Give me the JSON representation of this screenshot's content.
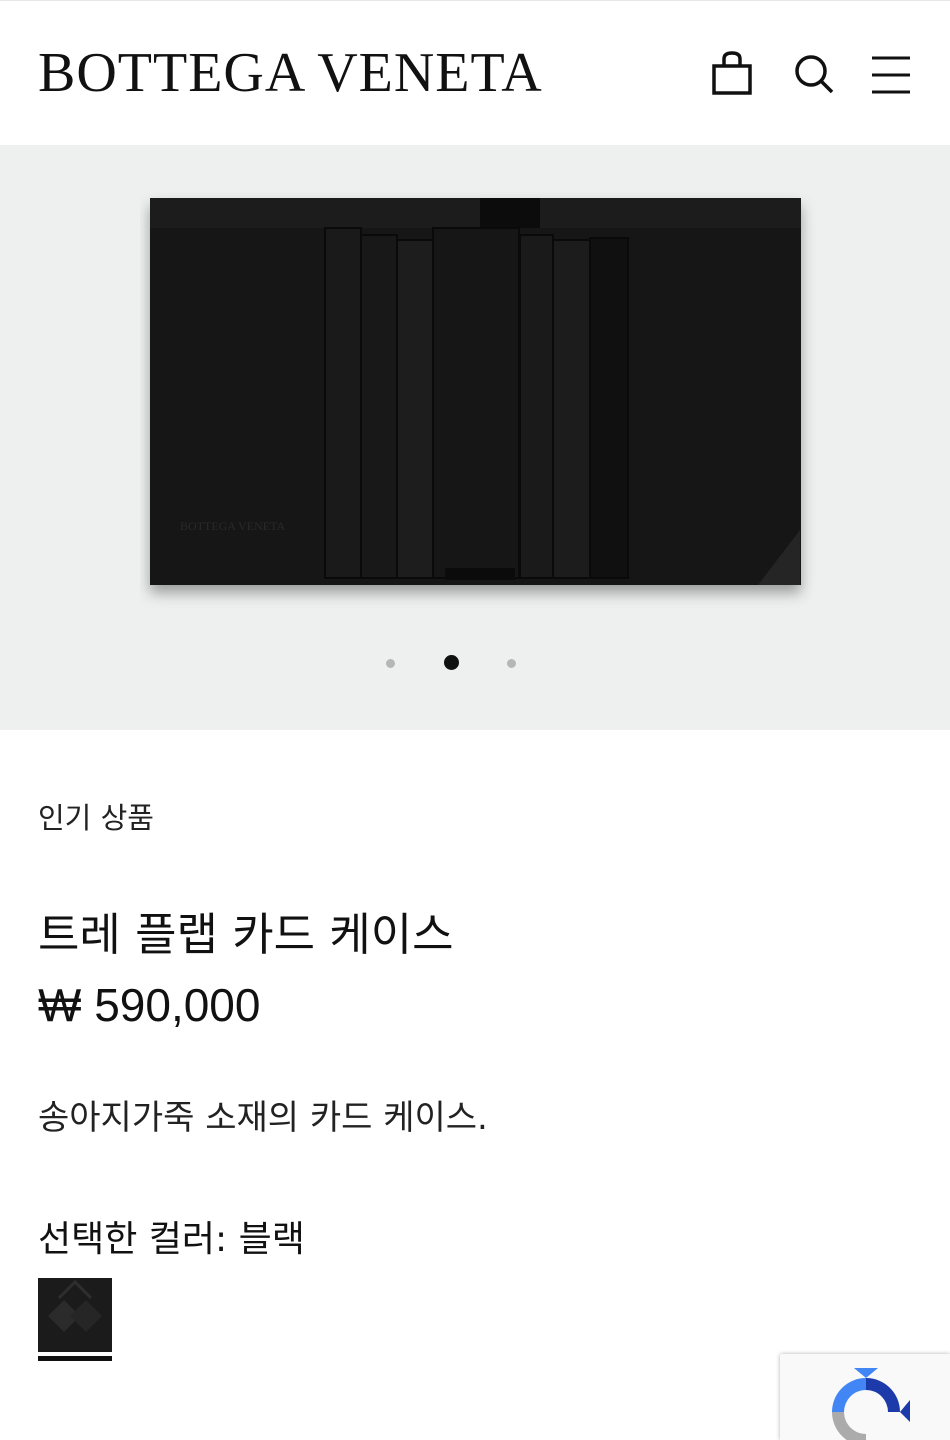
{
  "header": {
    "logo": "BOTTEGA VENETA",
    "icons": [
      "shopping-bag-icon",
      "search-icon",
      "menu-icon"
    ]
  },
  "gallery": {
    "slide_count": 3,
    "active_slide": 2
  },
  "product": {
    "badge": "인기 상품",
    "title": "트레 플랩 카드 케이스",
    "price": "₩ 590,000",
    "description": "송아지가죽 소재의 카드 케이스.",
    "color_label": "선택한 컬러:",
    "color_value": "블랙",
    "swatch_color": "#1b1b1b"
  },
  "colors": {
    "background": "#ffffff",
    "gallery_background": "#eef0f0",
    "text": "#111111",
    "dot_active": "#111111",
    "dot_inactive": "#b5b7b7"
  }
}
